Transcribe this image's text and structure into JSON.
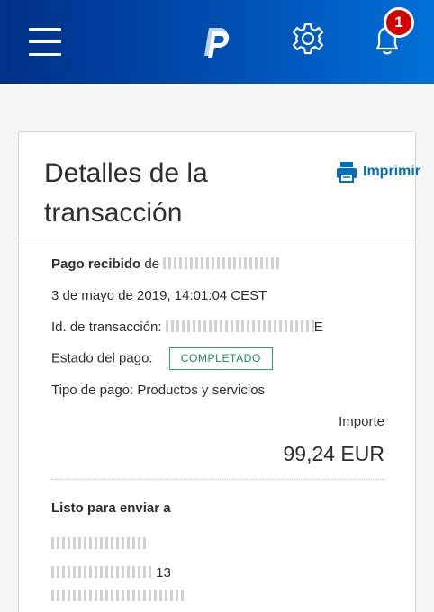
{
  "header": {
    "menu_icon": "hamburger-menu-icon",
    "logo_icon": "paypal-logo-icon",
    "settings_icon": "gear-icon",
    "notifications_icon": "bell-icon",
    "notification_count": "1",
    "brand_color_dark": "#003087",
    "brand_color_light": "#0070d6"
  },
  "card": {
    "title": "Detalles de la transacción",
    "print_label": "Imprimir",
    "print_icon": "printer-icon"
  },
  "details": {
    "payment_received_label": "Pago recibido",
    "payment_received_from": "de",
    "date": "3 de mayo de 2019, 14:01:04 CEST",
    "transaction_id_label": "Id. de transacción:",
    "transaction_id_suffix": "E",
    "status_label": "Estado del pago:",
    "status_value": "COMPLETADO",
    "status_color": "#2ba36b",
    "payment_type": "Tipo de pago: Productos y servicios",
    "amount_label": "Importe",
    "amount_value": "99,24 EUR"
  },
  "shipping": {
    "title": "Listo para enviar a",
    "address_line_number": "13"
  }
}
